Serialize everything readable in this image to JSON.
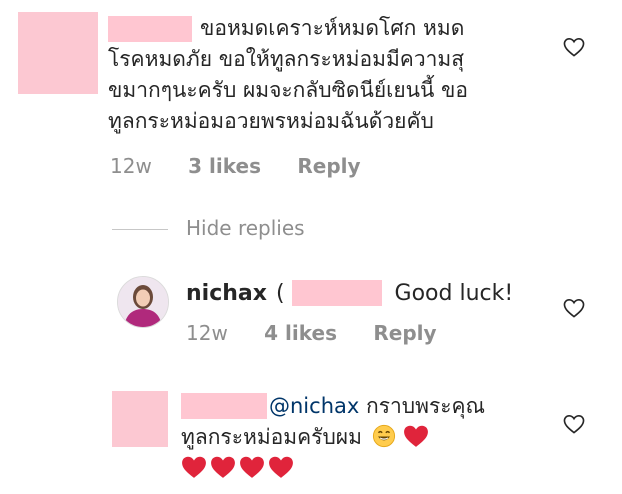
{
  "comment1": {
    "text_lines": [
      "ขอหมดเคราะห์หมดโศก หมด",
      "โรคหมดภัย ขอให้ทูลกระหม่อมมีความสุ",
      "ขมากๆนะครับ ผมจะกลับซิดนีย์เยนนี้ ขอ",
      "ทูลกระหม่อมอวยพรหม่อมฉันด้วยคับ"
    ],
    "age": "12w",
    "likes": "3 likes",
    "reply": "Reply"
  },
  "replies_toggle": "Hide replies",
  "reply1": {
    "username": "nichax",
    "paren_open": "(",
    "text": "Good luck!",
    "age": "12w",
    "likes": "4 likes",
    "reply": "Reply"
  },
  "reply2": {
    "mention": "@nichax",
    "text_line1": "กราบพระคุณ",
    "text_line2": "ทูลกระหม่อมครับผม"
  },
  "icons": {
    "like": "heart-outline-icon",
    "emoji": "grinning-face-emoji",
    "heart": "red-heart-emoji"
  },
  "colors": {
    "text": "#262626",
    "meta": "#8e8e8e",
    "mention": "#003569",
    "heart": "#e0243b",
    "redaction": "#ffc6d1"
  }
}
